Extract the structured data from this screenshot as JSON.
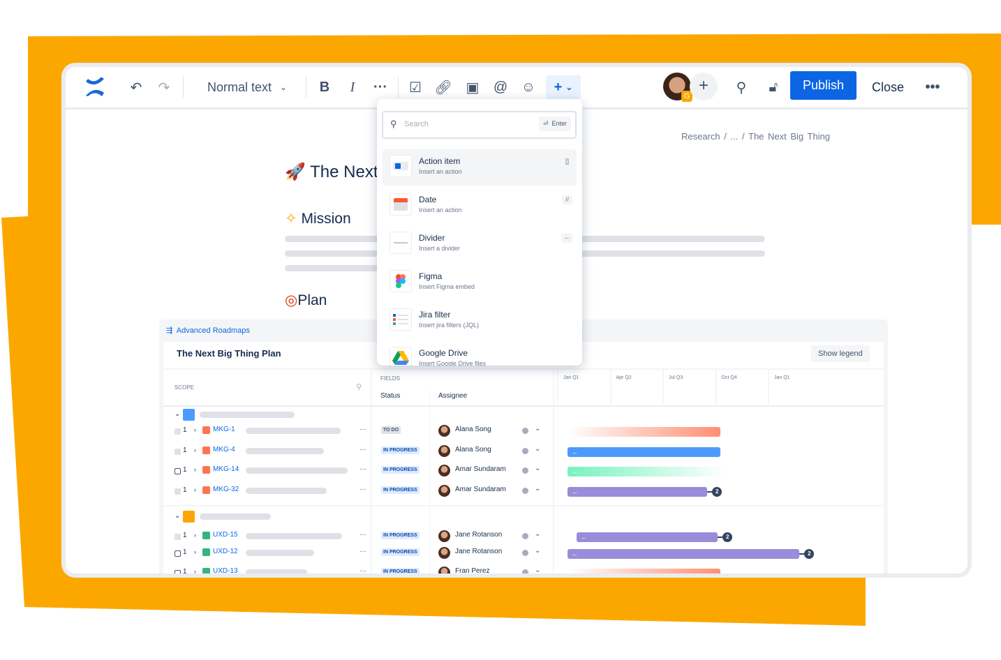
{
  "brand": {
    "accent": "#fca700",
    "primary": "#0c66e4"
  },
  "toolbar": {
    "text_style": "Normal text",
    "publish": "Publish",
    "close": "Close",
    "avatar_badge": "G"
  },
  "breadcrumb": [
    "Research",
    "/",
    "...",
    "/",
    "The Next Big Thing"
  ],
  "page": {
    "title": "The Next Big Thing",
    "mission": "Mission",
    "plan": "Plan"
  },
  "insert_menu": {
    "search_placeholder": "Search",
    "enter_label": "Enter",
    "items": [
      {
        "title": "Action item",
        "desc": "Insert an action",
        "shortcut": "[]",
        "icon": "action-item-icon"
      },
      {
        "title": "Date",
        "desc": "Insert an action",
        "shortcut": "//",
        "icon": "calendar-icon"
      },
      {
        "title": "Divider",
        "desc": "Insert a divider",
        "shortcut": "--",
        "icon": "divider-icon"
      },
      {
        "title": "Figma",
        "desc": "Insert Figma embed",
        "shortcut": "",
        "icon": "figma-icon"
      },
      {
        "title": "Jira filter",
        "desc": "Insert jira filters (JQL)",
        "shortcut": "",
        "icon": "jira-filter-icon"
      },
      {
        "title": "Google Drive",
        "desc": "Insert Google Drive files",
        "shortcut": "",
        "icon": "google-drive-icon"
      }
    ]
  },
  "roadmap": {
    "app_label": "Advanced Roadmaps",
    "plan_title": "The Next Big Thing Plan",
    "show_legend": "Show legend",
    "scope_label": "SCOPE",
    "fields_label": "FIELDS",
    "status_col": "Status",
    "assignee_col": "Assignee",
    "quarters": [
      "Jan Q1",
      "Apr Q2",
      "Jul Q3",
      "Oct Q4",
      "Jan Q1"
    ],
    "groups": [
      {
        "rows": [
          {
            "key": "MKG-1",
            "count": "1",
            "status": "TO DO",
            "assignee": "Alana Song",
            "bar": {
              "start_q": 0.2,
              "end_q": 3.1,
              "color": "#ff8f73",
              "style": "fade-left"
            }
          },
          {
            "key": "MKG-4",
            "count": "1",
            "status": "IN PROGRESS",
            "assignee": "Alana Song",
            "bar": {
              "start_q": 0.2,
              "end_q": 3.1,
              "color": "#4c9aff",
              "style": "solid"
            }
          },
          {
            "key": "MKG-14",
            "count": "1",
            "status": "IN PROGRESS",
            "assignee": "Amar Sundaram",
            "bar": {
              "start_q": 0.2,
              "end_q": 3.2,
              "color": "#79f2c0",
              "style": "fade-right"
            }
          },
          {
            "key": "MKG-32",
            "count": "1",
            "status": "IN PROGRESS",
            "assignee": "Amar Sundaram",
            "bar": {
              "start_q": 0.2,
              "end_q": 2.85,
              "color": "#998dd9",
              "style": "solid",
              "deps": "2"
            }
          }
        ]
      },
      {
        "rows": [
          {
            "key": "UXD-15",
            "count": "1",
            "status": "IN PROGRESS",
            "assignee": "Jane Rotanson",
            "bar": {
              "start_q": 0.37,
              "end_q": 3.05,
              "color": "#998dd9",
              "style": "solid",
              "deps": "2"
            }
          },
          {
            "key": "UXD-12",
            "count": "1",
            "status": "IN PROGRESS",
            "assignee": "Jane Rotanson",
            "bar": {
              "start_q": 0.2,
              "end_q": 4.6,
              "color": "#998dd9",
              "style": "solid",
              "deps": "2"
            }
          },
          {
            "key": "UXD-13",
            "count": "1",
            "status": "IN PROGRESS",
            "assignee": "Fran Perez",
            "bar": {
              "start_q": 0.2,
              "end_q": 3.1,
              "color": "#ff8f73",
              "style": "fade-left"
            }
          }
        ]
      }
    ]
  }
}
